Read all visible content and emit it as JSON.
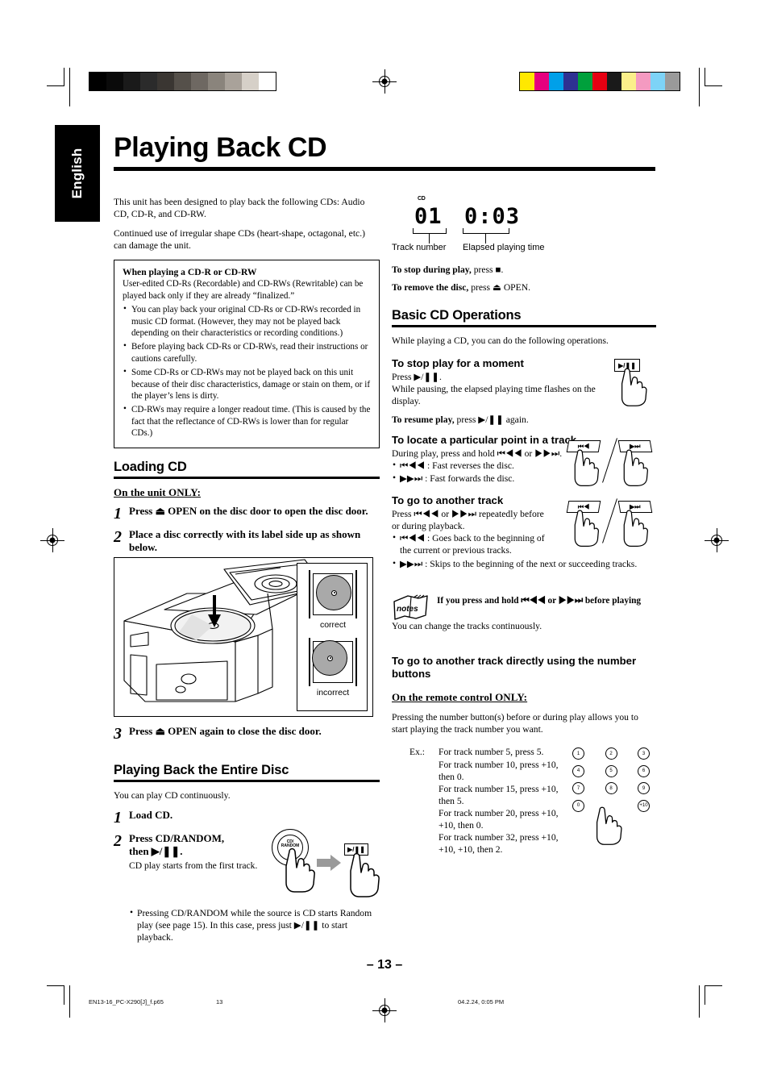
{
  "language_tab": "English",
  "title": "Playing Back CD",
  "intro": {
    "p1": "This unit has been designed to play back the following CDs: Audio CD, CD-R, and CD-RW.",
    "p2": "Continued use of irregular shape CDs (heart-shape, octagonal, etc.) can damage the unit."
  },
  "cdr_box": {
    "heading": "When playing a CD-R or CD-RW",
    "body": "User-edited CD-Rs (Recordable) and CD-RWs (Rewritable) can be played back only if they are already “finalized.”",
    "bullets": [
      "You can play back your original CD-Rs or CD-RWs recorded in music CD format. (However, they may not be played back depending on their characteristics or recording conditions.)",
      "Before playing back CD-Rs or CD-RWs, read their instructions or cautions carefully.",
      "Some CD-Rs or CD-RWs may not be played back on this unit because of their disc characteristics, damage or stain on them, or if the player’s lens is dirty.",
      "CD-RWs may require a longer readout time. (This is caused by the fact that the reflectance of CD-RWs is lower than for regular CDs.)"
    ]
  },
  "loading_cd": {
    "heading": "Loading CD",
    "subheading": "On the unit ONLY:",
    "steps": [
      {
        "num": "1",
        "text": "Press ⏏ OPEN on the disc door to open the disc door."
      },
      {
        "num": "2",
        "text": "Place a disc correctly with its label side up as shown below."
      },
      {
        "num": "3",
        "text": "Press ⏏ OPEN again to close the disc door."
      }
    ],
    "figure_labels": {
      "correct": "correct",
      "incorrect": "incorrect"
    }
  },
  "entire_disc": {
    "heading": "Playing Back the Entire Disc",
    "intro": "You can play CD continuously.",
    "step1_num": "1",
    "step1_text": "Load CD.",
    "step2_num": "2",
    "step2_line1": "Press CD/RANDOM,",
    "step2_line2": "then ▶/❚❚.",
    "step2_body": "CD play starts from the first track.",
    "step2_bullet": "Pressing CD/RANDOM while the source is CD starts Random play (see page 15). In this case, press just ▶/❚❚ to start playback.",
    "button_cd_random": "CD/ RANDOM",
    "button_play_pause": "▶/❚❚"
  },
  "display": {
    "cd_indicator": "CD",
    "track_value": "01",
    "time_value": "0:03",
    "track_label": "Track number",
    "time_label": "Elapsed playing time"
  },
  "stop_lines": {
    "stop_bold": "To stop during play,",
    "stop_rest": "press ■.",
    "remove_bold": "To remove the disc,",
    "remove_rest": "press ⏏ OPEN."
  },
  "basic_ops": {
    "heading": "Basic CD Operations",
    "intro": "While playing a CD, you can do the following operations.",
    "pause": {
      "heading": "To stop play for a moment",
      "line1": "Press ▶/❚❚.",
      "line2": "While pausing, the elapsed playing time flashes on the display.",
      "resume_bold": "To resume play,",
      "resume_rest": "press ▶/❚❚ again.",
      "button": "▶/❚❚"
    },
    "locate": {
      "heading": "To locate a particular point in a track",
      "line1": "During play, press and hold ⏮◀◀ or ▶▶⏭.",
      "bullets": [
        "⏮◀◀ :  Fast reverses the disc.",
        "▶▶⏭ :  Fast forwards the disc."
      ],
      "button_rew": "⏮◀",
      "button_ff": "▶⏭"
    },
    "another_track": {
      "heading": "To go to another track",
      "line1": "Press ⏮◀◀ or ▶▶⏭ repeatedly before or during playback.",
      "bullets": [
        "⏮◀◀ :  Goes back to the beginning of the current or previous tracks.",
        "▶▶⏭ :  Skips to the beginning of the next or succeeding tracks."
      ],
      "button_rew": "⏮◀",
      "button_ff": "▶⏭"
    }
  },
  "notes": {
    "badge": "notes",
    "heading": "If you press and hold ⏮◀◀ or ▶▶⏭ before playing",
    "body": "You can change the tracks continuously."
  },
  "number_buttons": {
    "heading": "To go to another track directly using the number buttons",
    "subheading": "On the remote control ONLY:",
    "intro": "Pressing the number button(s) before or during play allows you to start playing the track number you want.",
    "ex_label": "Ex.:",
    "examples": [
      "For track number 5, press 5.",
      "For track number 10, press +10, then 0.",
      "For track number 15, press +10, then 5.",
      "For track number 20, press +10, +10, then 0.",
      "For track number 32, press +10, +10, +10, then 2."
    ],
    "keypad": [
      [
        "1",
        "2",
        "3"
      ],
      [
        "4",
        "5",
        "6"
      ],
      [
        "7",
        "8",
        "9"
      ],
      [
        "0",
        "",
        "+10"
      ]
    ]
  },
  "footer": {
    "page_number": "– 13 –",
    "filename": "EN13-16_PC-X290[J]_f.p65",
    "folio": "13",
    "timestamp": "04.2.24, 0:05 PM"
  },
  "print_marks": {
    "grayscale": [
      "#000000",
      "#0a0a0a",
      "#1a1a1a",
      "#2b2b2b",
      "#3a3632",
      "#55504a",
      "#6e6862",
      "#8a847c",
      "#a9a29a",
      "#d6d0c8",
      "#ffffff"
    ],
    "colors": [
      "#ffe800",
      "#e6007e",
      "#00a0e9",
      "#2e3192",
      "#00a03c",
      "#e60012",
      "#1a1a1a",
      "#fbef8a",
      "#f49ac1",
      "#7dd3f7",
      "#9a9a9a"
    ]
  }
}
